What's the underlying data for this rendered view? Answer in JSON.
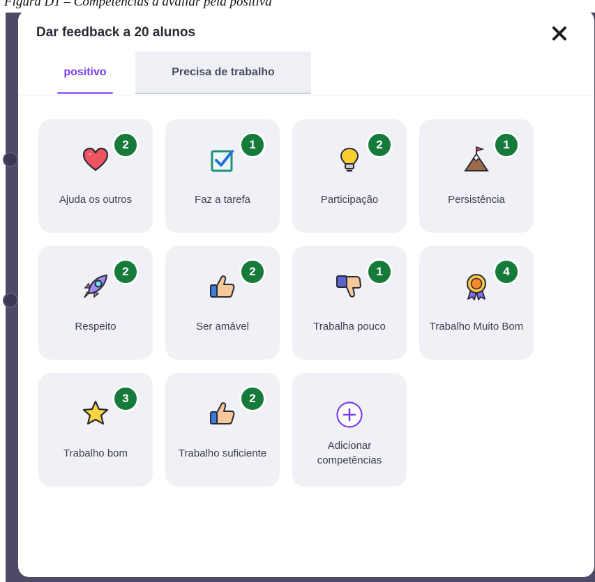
{
  "caption": "Figura D1 – Competências a avaliar pela positiva",
  "modal": {
    "title": "Dar feedback a 20 alunos",
    "close_icon": "close-icon"
  },
  "tabs": [
    {
      "label": "positivo",
      "active": true
    },
    {
      "label": "Precisa de trabalho",
      "active": false
    }
  ],
  "skills": [
    {
      "label": "Ajuda os outros",
      "count": "2",
      "icon": "heart-icon"
    },
    {
      "label": "Faz a tarefa",
      "count": "1",
      "icon": "checkbox-icon"
    },
    {
      "label": "Participação",
      "count": "2",
      "icon": "lightbulb-icon"
    },
    {
      "label": "Persistência",
      "count": "1",
      "icon": "mountain-flag-icon"
    },
    {
      "label": "Respeito",
      "count": "2",
      "icon": "rocket-icon"
    },
    {
      "label": "Ser amável",
      "count": "2",
      "icon": "thumbs-up-icon"
    },
    {
      "label": "Trabalha pouco",
      "count": "1",
      "icon": "thumbs-down-icon"
    },
    {
      "label": "Trabalho Muito Bom",
      "count": "4",
      "icon": "award-ribbon-icon"
    },
    {
      "label": "Trabalho bom",
      "count": "3",
      "icon": "star-icon"
    },
    {
      "label": "Trabalho suficiente",
      "count": "2",
      "icon": "thumbs-up-icon"
    }
  ],
  "add_skill": {
    "label": "Adicionar competências",
    "icon": "plus-circle-icon"
  },
  "colors": {
    "accent": "#7a3cf0",
    "badge": "#157a3a",
    "tile_bg": "#eff1f6",
    "backdrop": "#4e4a66"
  }
}
